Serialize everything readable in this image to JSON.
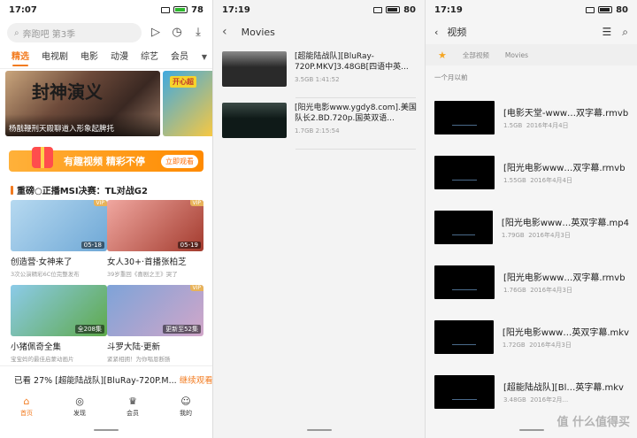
{
  "panel1": {
    "status": {
      "time": "17:07",
      "battery": "78"
    },
    "search": {
      "placeholder": "奔跑吧 第3季"
    },
    "tabs": [
      "精选",
      "电视剧",
      "电影",
      "动漫",
      "综艺",
      "会员"
    ],
    "banner": {
      "title": "封神演义",
      "caption": "杨戬鞭刑天殿聊道入形象起脾托"
    },
    "banner2": {
      "label": "开心超"
    },
    "promo": {
      "text": "有趣视频 精彩不停",
      "button": "立即观看"
    },
    "section": {
      "title": "重磅○正播MSI决赛：TL对战G2"
    },
    "cards": [
      {
        "title": "创造营·女神来了",
        "sub": "3次公演精彩6C位完整发布",
        "tag": "05-18",
        "vip": "VIP",
        "c1": "#b6d9f0",
        "c2": "#6fa8d6"
      },
      {
        "title": "女人30+·首播张柏芝",
        "sub": "39岁重回《喜剧之王》哭了",
        "tag": "05-19",
        "vip": "VIP",
        "c1": "#f0a7a0",
        "c2": "#a33b2e"
      },
      {
        "title": "小猪佩奇全集",
        "sub": "宝宝妈的最佳启蒙动画片",
        "tag": "全208集",
        "vip": "",
        "c1": "#8ccbe9",
        "c2": "#5ea94a"
      },
      {
        "title": "斗罗大陆·更新",
        "sub": "紧紧相拥！为你唱恩断肠",
        "tag": "更新至52集",
        "vip": "VIP",
        "c1": "#7ea3d8",
        "c2": "#d1a6c9"
      }
    ],
    "resume": {
      "progress": "已看 27%",
      "title": "[超能陆战队][BluRay-720P.M...",
      "action": "继续观看"
    },
    "nav": [
      {
        "label": "首页",
        "icon": "home-icon",
        "glyph": "⌂",
        "active": true
      },
      {
        "label": "发现",
        "icon": "discover-icon",
        "glyph": "◎",
        "active": false
      },
      {
        "label": "会员",
        "icon": "crown-icon",
        "glyph": "♛",
        "active": false
      },
      {
        "label": "我的",
        "icon": "profile-icon",
        "glyph": "☺",
        "active": false
      }
    ]
  },
  "panel2": {
    "status": {
      "time": "17:19",
      "battery": "80"
    },
    "header": "Movies",
    "items": [
      {
        "title": "[超能陆战队][BluRay-720P.MKV]3.48GB[四语中英...",
        "meta": "3.5GB  1:41:52",
        "c1": "#2a2a2a",
        "c2": "#8a8a8a"
      },
      {
        "title": "[阳光电影www.ygdy8.com].美国队长2.BD.720p.国英双语...",
        "meta": "1.7GB  2:15:54",
        "c1": "#0f1a18",
        "c2": "#3b4a46"
      }
    ]
  },
  "panel3": {
    "status": {
      "time": "17:19",
      "battery": "80"
    },
    "header": "视频",
    "crumbs": [
      "全部视频",
      "Movies"
    ],
    "group": "一个月以前",
    "items": [
      {
        "title": "[电影天堂-www…双字幕.rmvb",
        "size": "1.5GB",
        "date": "2016年4月4日"
      },
      {
        "title": "[阳光电影www…双字幕.rmvb",
        "size": "1.55GB",
        "date": "2016年4月4日"
      },
      {
        "title": "[阳光电影www…英双字幕.mp4",
        "size": "1.79GB",
        "date": "2016年4月3日"
      },
      {
        "title": "[阳光电影www…双字幕.rmvb",
        "size": "1.76GB",
        "date": "2016年4月3日"
      },
      {
        "title": "[阳光电影www…英双字幕.mkv",
        "size": "1.72GB",
        "date": "2016年4月3日"
      },
      {
        "title": "[超能陆战队][Bl…英字幕.mkv",
        "size": "3.48GB",
        "date": "2016年2月..."
      }
    ],
    "watermark": "值 什么值得买"
  }
}
